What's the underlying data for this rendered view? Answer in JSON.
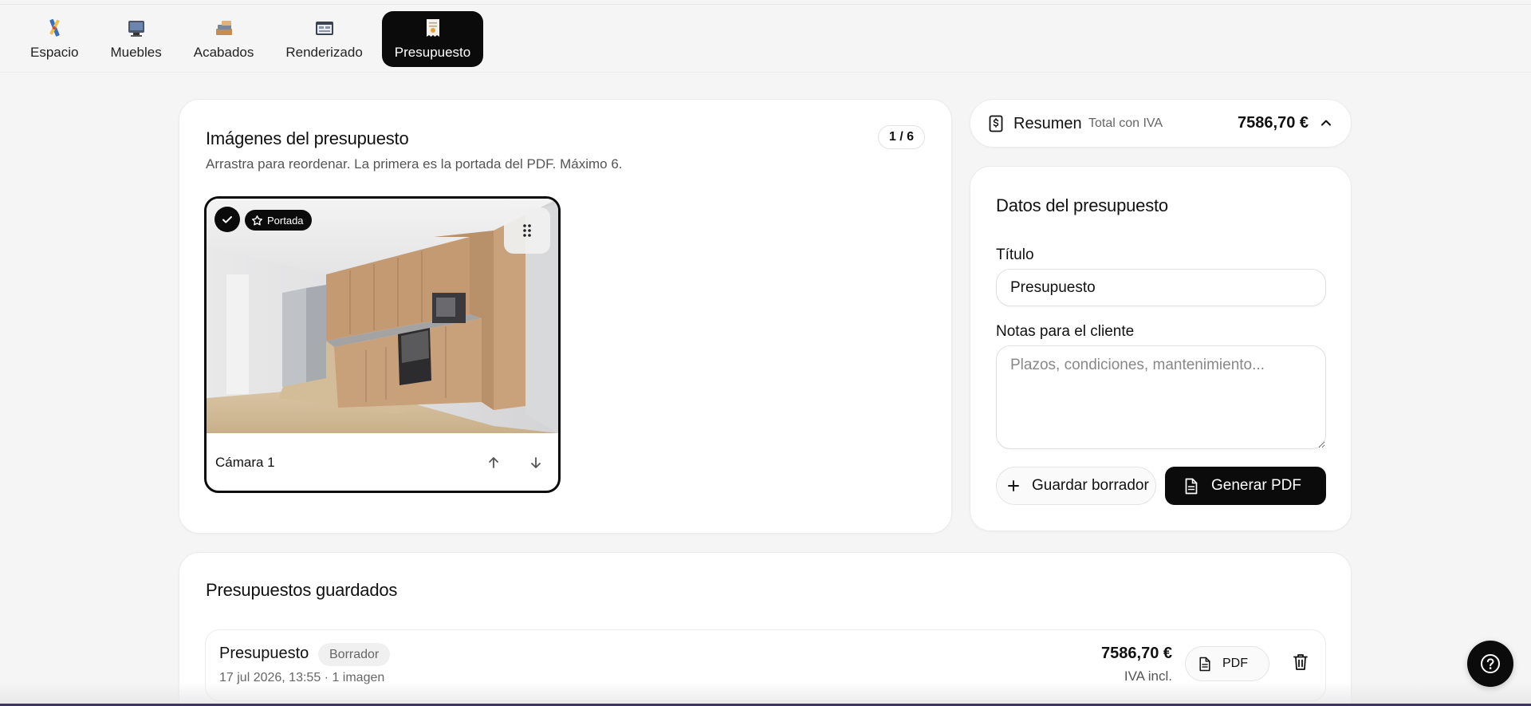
{
  "tabs": [
    {
      "label": "Espacio",
      "icon": "ruler-pencil-icon"
    },
    {
      "label": "Muebles",
      "icon": "furniture-icon"
    },
    {
      "label": "Acabados",
      "icon": "finishes-icon"
    },
    {
      "label": "Renderizado",
      "icon": "render-icon"
    },
    {
      "label": "Presupuesto",
      "icon": "receipt-icon",
      "active": true
    }
  ],
  "images": {
    "title": "Imágenes del presupuesto",
    "subtitle": "Arrastra para reordenar. La primera es la portada del PDF. Máximo 6.",
    "counter": "1 / 6",
    "items": [
      {
        "cover_label": "Portada",
        "camera_label": "Cámara 1"
      }
    ]
  },
  "summary": {
    "title": "Resumen",
    "subtitle": "Total con IVA",
    "total": "7586,70 €"
  },
  "datos": {
    "heading": "Datos del presupuesto",
    "title_label": "Título",
    "title_value": "Presupuesto",
    "notes_label": "Notas para el cliente",
    "notes_placeholder": "Plazos, condiciones, mantenimiento...",
    "save_draft_label": "Guardar borrador",
    "generate_pdf_label": "Generar PDF"
  },
  "saved": {
    "heading": "Presupuestos guardados",
    "rows": [
      {
        "title": "Presupuesto",
        "status": "Borrador",
        "meta": "17 jul 2026, 13:55 · 1 imagen",
        "amount": "7586,70 €",
        "vat": "IVA incl.",
        "pdf_label": "PDF"
      }
    ]
  },
  "colors": {
    "accent": "#0b0b0b",
    "background": "#f5f5f5",
    "card": "#ffffff"
  }
}
